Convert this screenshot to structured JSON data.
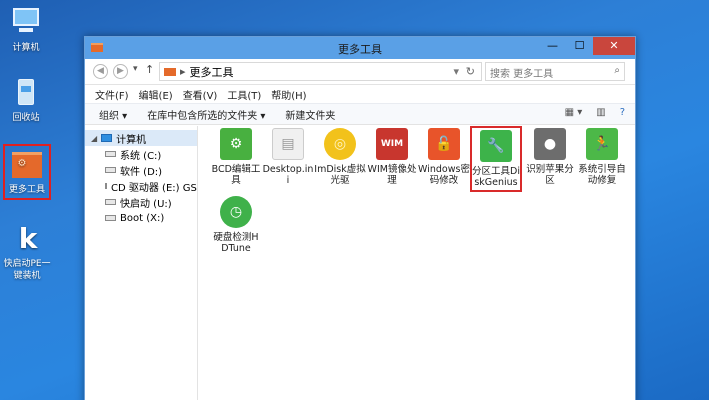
{
  "desktop": {
    "icons": [
      {
        "label": "计算机",
        "icon": "computer-icon"
      },
      {
        "label": "回收站",
        "icon": "recycle-bin-icon"
      },
      {
        "label": "更多工具",
        "icon": "folder-icon"
      },
      {
        "label": "快启动PE一键装机",
        "icon": "k-app-icon"
      }
    ]
  },
  "window": {
    "title": "更多工具",
    "controls": {
      "minimize": "—",
      "maximize": "☐",
      "close": "✕"
    },
    "address": {
      "path": "更多工具",
      "refresh": "↻"
    },
    "search": {
      "placeholder": "搜索 更多工具"
    },
    "menu": [
      "文件(F)",
      "编辑(E)",
      "查看(V)",
      "工具(T)",
      "帮助(H)"
    ],
    "commands": {
      "organize": "组织 ▾",
      "include": "在库中包含所选的文件夹 ▾",
      "newfolder": "新建文件夹"
    },
    "nav": [
      {
        "label": "计算机",
        "kind": "pc"
      },
      {
        "label": "系统 (C:)",
        "kind": "drive"
      },
      {
        "label": "软件 (D:)",
        "kind": "drive"
      },
      {
        "label": "CD 驱动器 (E:) GSP",
        "kind": "drive"
      },
      {
        "label": "快启动 (U:)",
        "kind": "drive"
      },
      {
        "label": "Boot (X:)",
        "kind": "drive"
      }
    ],
    "files": [
      {
        "label": "BCD编辑工具",
        "icon": "gear-icon",
        "color": "#48b040",
        "glyph": "⚙"
      },
      {
        "label": "Desktop.ini",
        "icon": "ini-file-icon",
        "color": "#e8e8e8",
        "glyph": "▤"
      },
      {
        "label": "ImDisk虚拟光驱",
        "icon": "disc-icon",
        "color": "#f2c21b",
        "glyph": "◎"
      },
      {
        "label": "WIM镜像处理",
        "icon": "wim-icon",
        "color": "#c8362e",
        "glyph": "WIM"
      },
      {
        "label": "Windows密码修改",
        "icon": "unlock-icon",
        "color": "#e8542a",
        "glyph": "🔓"
      },
      {
        "label": "分区工具DiskGenius",
        "icon": "wrench-icon",
        "color": "#3db34a",
        "glyph": "🔧"
      },
      {
        "label": "识别苹果分区",
        "icon": "apple-icon",
        "color": "#6d6d6d",
        "glyph": ""
      },
      {
        "label": "系统引导自动修复",
        "icon": "run-icon",
        "color": "#4cb848",
        "glyph": "🏃"
      },
      {
        "label": "硬盘检测HDTune",
        "icon": "clock-icon",
        "color": "#3fb14a",
        "glyph": "◷"
      }
    ]
  }
}
